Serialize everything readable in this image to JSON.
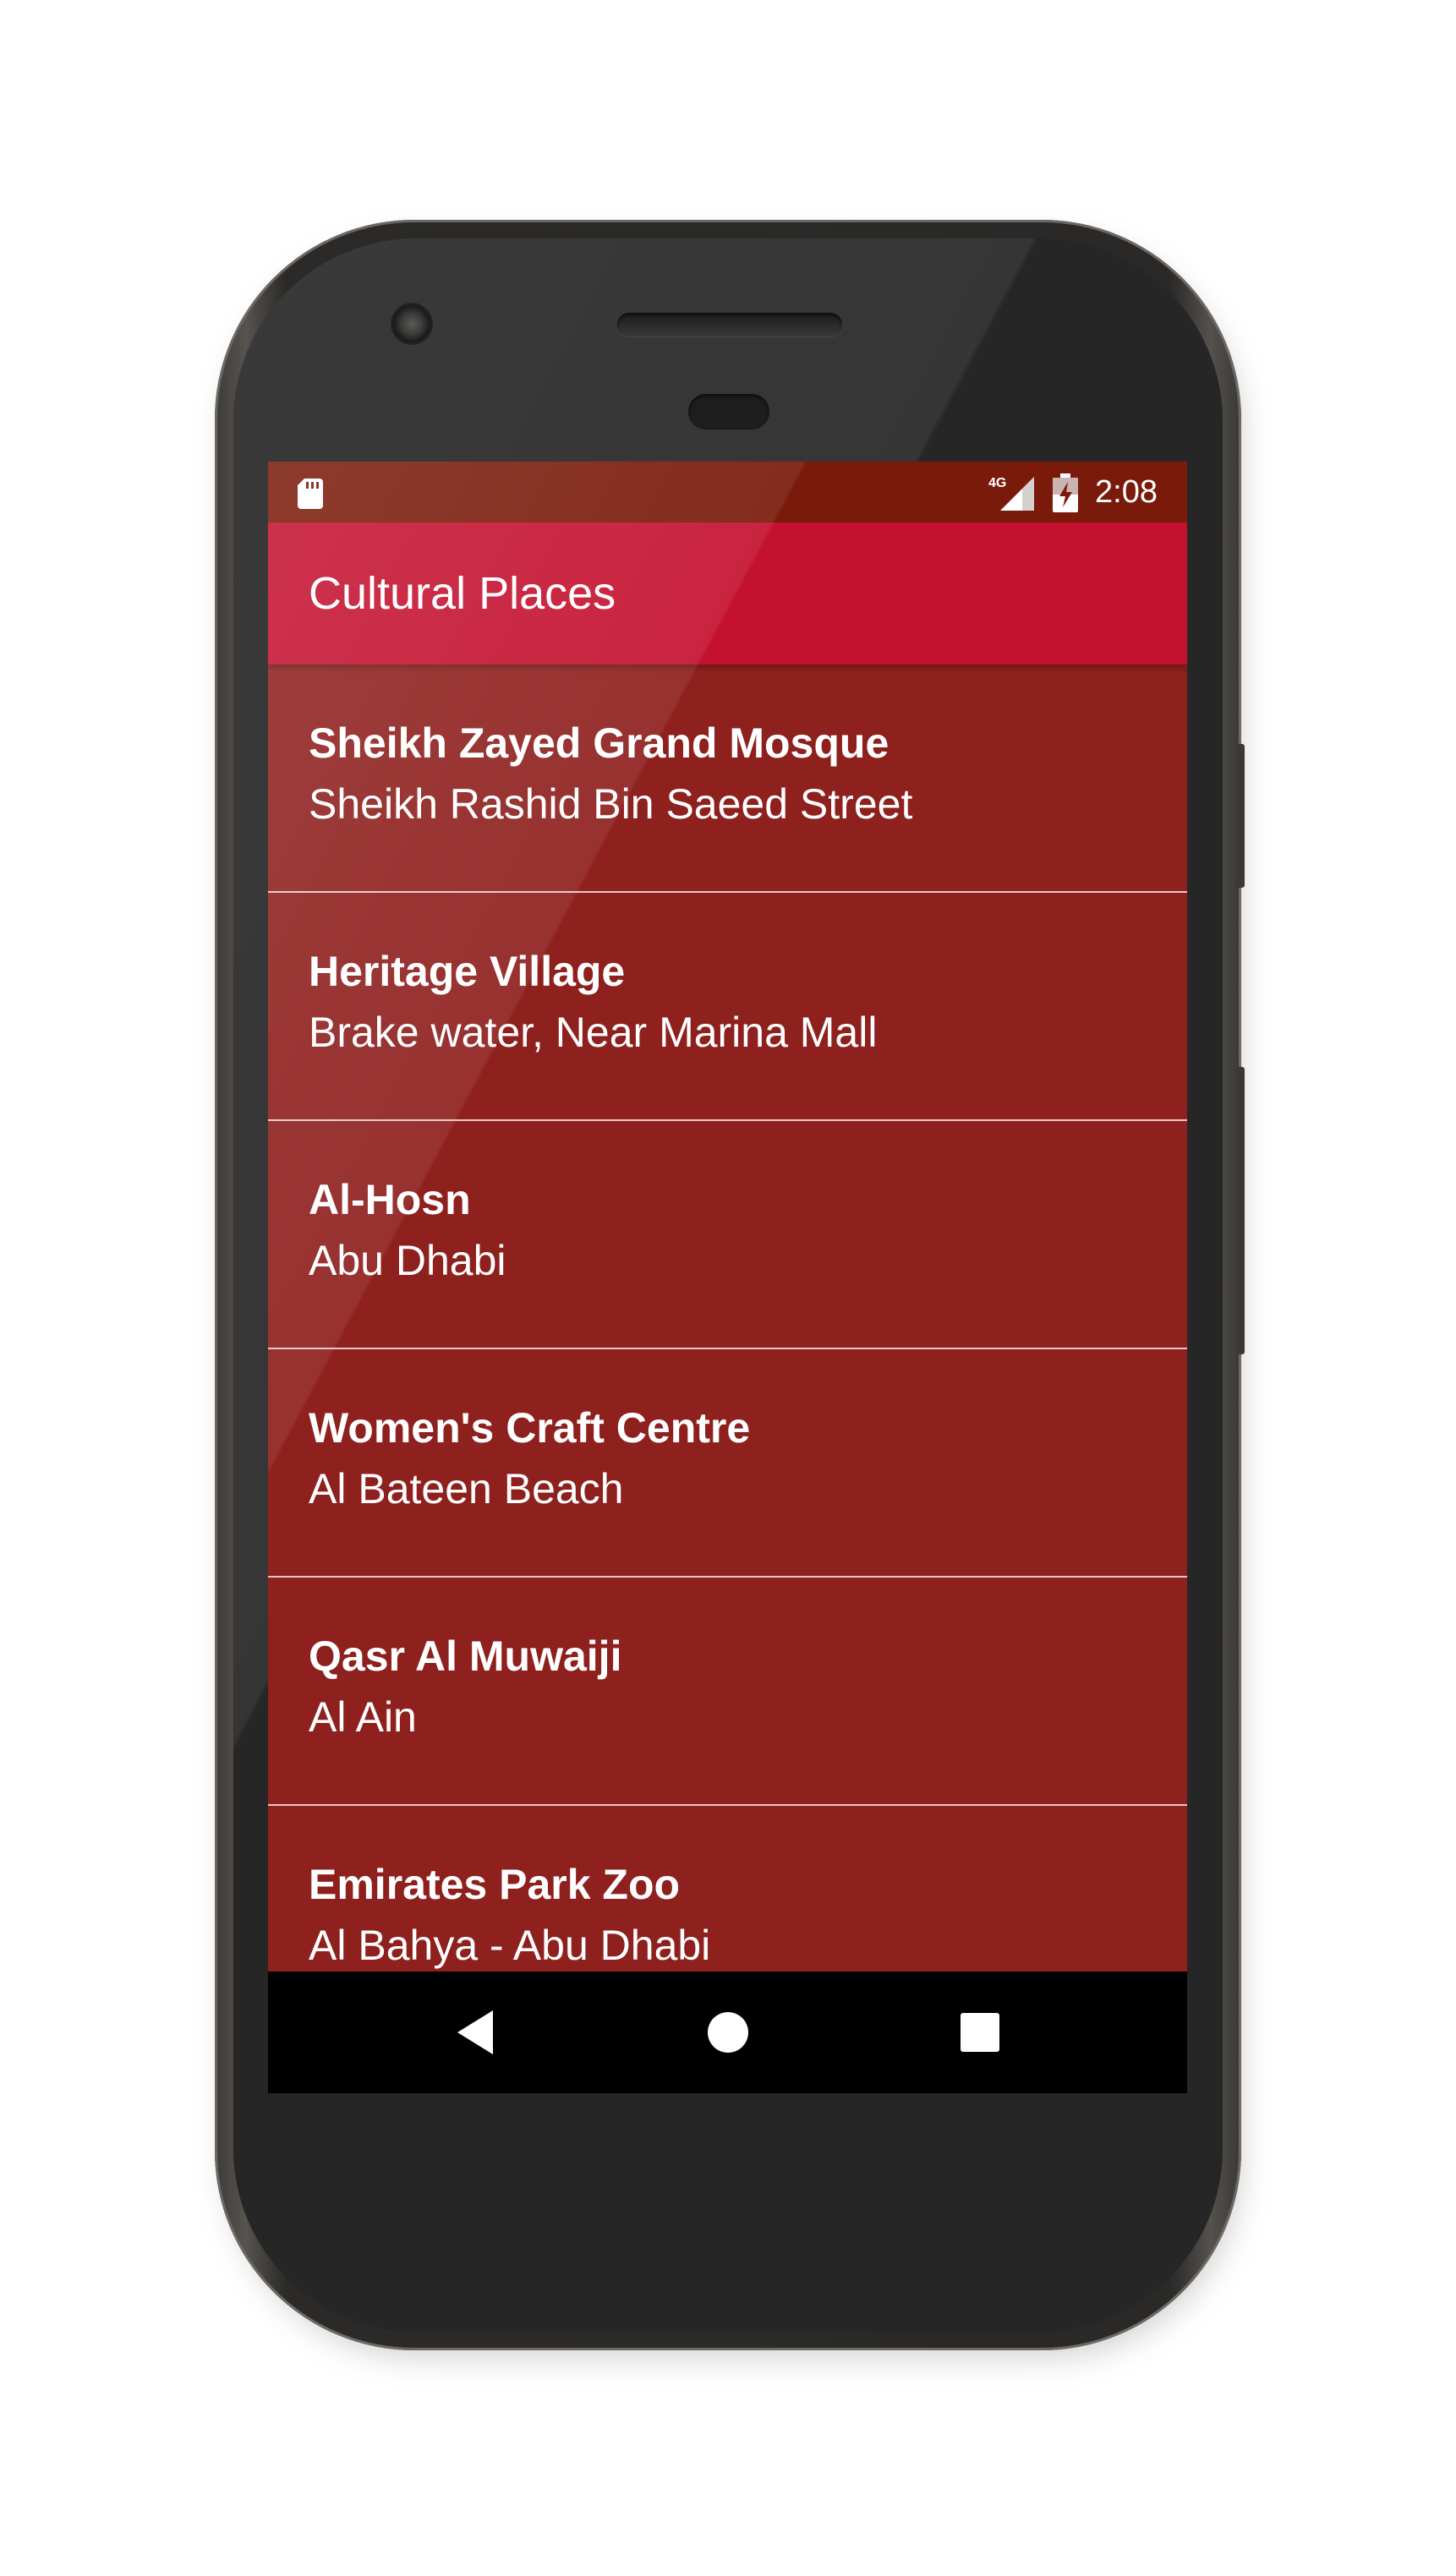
{
  "status_bar": {
    "time": "2:08",
    "network": "4G",
    "icons": [
      "sd-card-icon",
      "signal-4g-icon",
      "battery-charging-icon"
    ]
  },
  "app_bar": {
    "title": "Cultural Places",
    "color": "#c4112f"
  },
  "places": [
    {
      "name": "Sheikh Zayed Grand Mosque",
      "address": "Sheikh Rashid Bin Saeed Street"
    },
    {
      "name": "Heritage Village",
      "address": "Brake water, Near Marina Mall"
    },
    {
      "name": "Al-Hosn",
      "address": "Abu Dhabi"
    },
    {
      "name": "Women's Craft Centre",
      "address": "Al Bateen Beach"
    },
    {
      "name": "Qasr Al Muwaiji",
      "address": "Al Ain"
    },
    {
      "name": "Emirates Park Zoo",
      "address": "Al Bahya - Abu Dhabi"
    }
  ],
  "nav_bar": {
    "buttons": [
      "back-icon",
      "home-icon",
      "recents-icon"
    ]
  },
  "colors": {
    "list_background": "#8e201e",
    "status_bar": "#7a1a0a",
    "divider": "#e8c7c6",
    "nav_bar": "#000000"
  }
}
